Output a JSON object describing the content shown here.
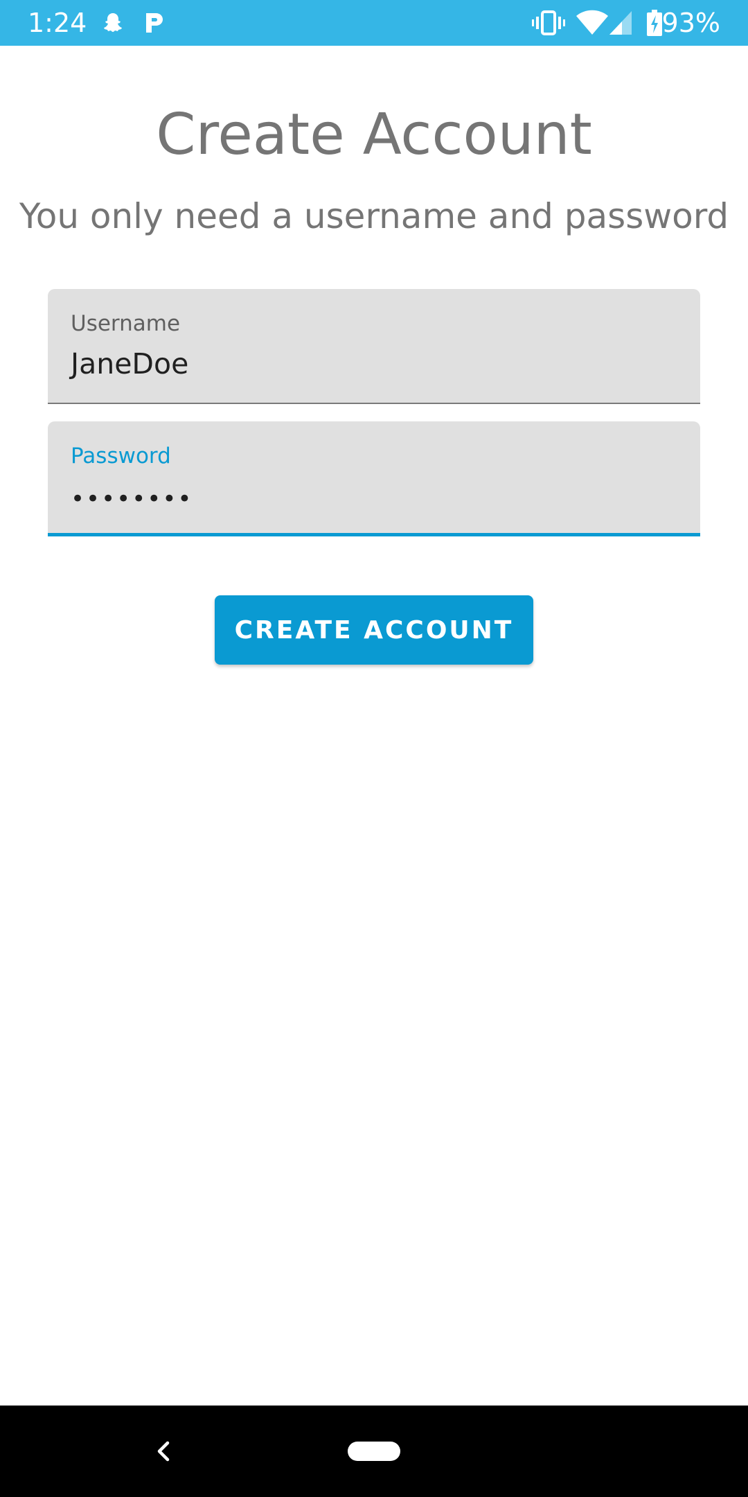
{
  "status_bar": {
    "time": "1:24",
    "battery_percent": "93%",
    "background_color": "#35b6e6",
    "notification_icons": [
      "snapchat-icon",
      "pandora-icon"
    ],
    "system_icons": [
      "vibrate-icon",
      "wifi-icon",
      "signal-icon",
      "battery-charging-icon"
    ]
  },
  "header": {
    "title": "Create Account",
    "subtitle": "You only need a username and password"
  },
  "form": {
    "username": {
      "label": "Username",
      "value": "JaneDoe"
    },
    "password": {
      "label": "Password",
      "value": "••••••••",
      "focused": true
    },
    "submit_label": "CREATE ACCOUNT",
    "accent_color": "#0a9ad2"
  },
  "nav_bar": {
    "icons": [
      "back-icon",
      "home-pill-icon"
    ]
  }
}
